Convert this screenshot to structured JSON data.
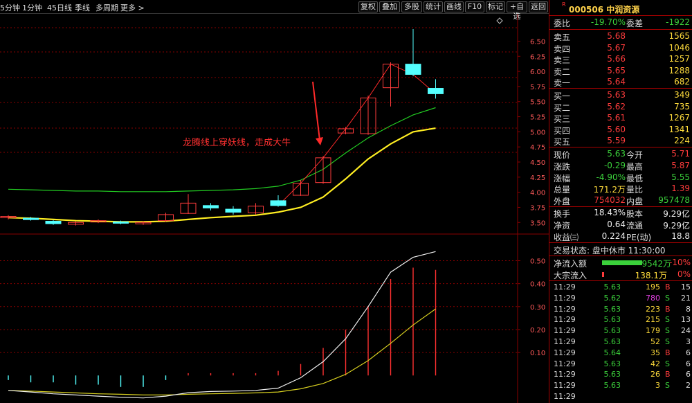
{
  "toolbar": {
    "periods": [
      "5分钟",
      "1分钟",
      "45日线",
      "季线",
      "多周期",
      "更多 >"
    ],
    "buttons": [
      "复权",
      "叠加",
      "多股",
      "统计",
      "画线",
      "F10",
      "标记",
      "+自选",
      "返回"
    ]
  },
  "stock": {
    "badge": "R",
    "title": "000506 中润资源"
  },
  "summary": {
    "weibi_label": "委比",
    "weibi": "-19.70%",
    "weicha_label": "委差",
    "weicha": "-1922"
  },
  "asks": [
    {
      "label": "卖五",
      "price": "5.68",
      "vol": "1565"
    },
    {
      "label": "卖四",
      "price": "5.67",
      "vol": "1046"
    },
    {
      "label": "卖三",
      "price": "5.66",
      "vol": "1257"
    },
    {
      "label": "卖二",
      "price": "5.65",
      "vol": "1288"
    },
    {
      "label": "卖一",
      "price": "5.64",
      "vol": "682"
    }
  ],
  "bids": [
    {
      "label": "买一",
      "price": "5.63",
      "vol": "349"
    },
    {
      "label": "买二",
      "price": "5.62",
      "vol": "735"
    },
    {
      "label": "买三",
      "price": "5.61",
      "vol": "1267"
    },
    {
      "label": "买四",
      "price": "5.60",
      "vol": "1341"
    },
    {
      "label": "买五",
      "price": "5.59",
      "vol": "224"
    }
  ],
  "quote": [
    {
      "l1": "现价",
      "v1": "5.63",
      "c1": "green",
      "l2": "今开",
      "v2": "5.71",
      "c2": "red"
    },
    {
      "l1": "涨跌",
      "v1": "-0.29",
      "c1": "green",
      "l2": "最高",
      "v2": "5.87",
      "c2": "red"
    },
    {
      "l1": "涨幅",
      "v1": "-4.90%",
      "c1": "green",
      "l2": "最低",
      "v2": "5.55",
      "c2": "green"
    },
    {
      "l1": "总量",
      "v1": "171.2万",
      "c1": "yellow",
      "l2": "量比",
      "v2": "1.39",
      "c2": "red"
    },
    {
      "l1": "外盘",
      "v1": "754032",
      "c1": "red",
      "l2": "内盘",
      "v2": "957478",
      "c2": "green"
    }
  ],
  "fundamentals": [
    {
      "l1": "换手",
      "v1": "18.43%",
      "l2": "股本",
      "v2": "9.29亿"
    },
    {
      "l1": "净资",
      "v1": "0.64",
      "l2": "流通",
      "v2": "9.29亿"
    },
    {
      "l1": "收益㈢",
      "v1": "0.224",
      "l2": "PE(动)",
      "v2": "18.8"
    }
  ],
  "trade_status": "交易状态: 盘中休市 11:30:00",
  "flows": {
    "net_label": "净流入额",
    "net_value": "-9542万",
    "net_pct": "-10%",
    "big_label": "大宗流入",
    "big_value": "138.1万",
    "big_pct": "0%"
  },
  "ticks": [
    {
      "time": "11:29",
      "price": "5.63",
      "vol": "195",
      "side": "B",
      "n": "15"
    },
    {
      "time": "11:29",
      "price": "5.62",
      "vol": "780",
      "side": "S",
      "n": "21"
    },
    {
      "time": "11:29",
      "price": "5.63",
      "vol": "223",
      "side": "B",
      "n": "8"
    },
    {
      "time": "11:29",
      "price": "5.63",
      "vol": "215",
      "side": "S",
      "n": "13"
    },
    {
      "time": "11:29",
      "price": "5.63",
      "vol": "179",
      "side": "S",
      "n": "24"
    },
    {
      "time": "11:29",
      "price": "5.63",
      "vol": "52",
      "side": "S",
      "n": "3"
    },
    {
      "time": "11:29",
      "price": "5.64",
      "vol": "35",
      "side": "B",
      "n": "6"
    },
    {
      "time": "11:29",
      "price": "5.63",
      "vol": "42",
      "side": "S",
      "n": "6"
    },
    {
      "time": "11:29",
      "price": "5.63",
      "vol": "26",
      "side": "B",
      "n": "6"
    },
    {
      "time": "11:29",
      "price": "5.63",
      "vol": "3",
      "side": "S",
      "n": "2"
    },
    {
      "time": "11:29",
      "price": "",
      "vol": "",
      "side": "",
      "n": ""
    }
  ],
  "colors": {
    "up": "#ff3c3c",
    "down": "#3bd13b",
    "down_candle": "#54ffff",
    "ma_yellow": "#ffee22",
    "ma_green": "#22cc22",
    "grid": "#8a0000"
  },
  "chart_data": [
    {
      "type": "candlestick",
      "title": "",
      "annotation": "龙腾线上穿妖线，走成大牛",
      "yticks": [
        "6.50",
        "6.25",
        "6.00",
        "5.75",
        "5.50",
        "5.25",
        "5.00",
        "4.75",
        "4.50",
        "4.25",
        "4.00",
        "3.75",
        "3.50"
      ],
      "ylim": [
        3.4,
        6.7
      ],
      "candles": [
        {
          "o": 3.58,
          "c": 3.6,
          "h": 3.62,
          "l": 3.55
        },
        {
          "o": 3.57,
          "c": 3.55,
          "h": 3.59,
          "l": 3.53
        },
        {
          "o": 3.52,
          "c": 3.48,
          "h": 3.54,
          "l": 3.46
        },
        {
          "o": 3.47,
          "c": 3.5,
          "h": 3.52,
          "l": 3.45
        },
        {
          "o": 3.51,
          "c": 3.53,
          "h": 3.55,
          "l": 3.49
        },
        {
          "o": 3.51,
          "c": 3.49,
          "h": 3.53,
          "l": 3.47
        },
        {
          "o": 3.48,
          "c": 3.5,
          "h": 3.52,
          "l": 3.46
        },
        {
          "o": 3.53,
          "c": 3.63,
          "h": 3.66,
          "l": 3.51
        },
        {
          "o": 3.65,
          "c": 3.82,
          "h": 3.97,
          "l": 3.64
        },
        {
          "o": 3.78,
          "c": 3.74,
          "h": 3.82,
          "l": 3.7
        },
        {
          "o": 3.72,
          "c": 3.67,
          "h": 3.77,
          "l": 3.63
        },
        {
          "o": 3.66,
          "c": 3.77,
          "h": 3.82,
          "l": 3.63
        },
        {
          "o": 3.86,
          "c": 3.78,
          "h": 3.95,
          "l": 3.76
        },
        {
          "o": 3.95,
          "c": 4.15,
          "h": 4.2,
          "l": 3.94
        },
        {
          "o": 4.16,
          "c": 4.57,
          "h": 4.6,
          "l": 4.14
        },
        {
          "o": 4.98,
          "c": 5.05,
          "h": 5.08,
          "l": 4.96
        },
        {
          "o": 4.97,
          "c": 5.56,
          "h": 5.6,
          "l": 4.95
        },
        {
          "o": 5.73,
          "c": 6.12,
          "h": 6.15,
          "l": 5.42
        },
        {
          "o": 6.12,
          "c": 5.95,
          "h": 6.7,
          "l": 5.92
        },
        {
          "o": 5.72,
          "c": 5.63,
          "h": 5.87,
          "l": 5.55
        }
      ],
      "ma_yellow": [
        3.58,
        3.57,
        3.55,
        3.53,
        3.52,
        3.51,
        3.51,
        3.52,
        3.55,
        3.58,
        3.6,
        3.62,
        3.67,
        3.75,
        3.92,
        4.22,
        4.55,
        4.8,
        5.0,
        5.06
      ],
      "ma_green": [
        4.05,
        4.04,
        4.03,
        4.02,
        4.02,
        4.01,
        4.01,
        4.01,
        4.02,
        4.03,
        4.04,
        4.06,
        4.1,
        4.2,
        4.38,
        4.65,
        4.9,
        5.1,
        5.28,
        5.4
      ]
    },
    {
      "type": "line",
      "title": "",
      "yticks": [
        "0.50",
        "0.40",
        "0.30",
        "0.20",
        "0.10"
      ],
      "ylim": [
        -0.12,
        0.58
      ],
      "series": [
        {
          "values": [
            -0.065,
            -0.072,
            -0.08,
            -0.085,
            -0.09,
            -0.095,
            -0.098,
            -0.09,
            -0.075,
            -0.07,
            -0.068,
            -0.065,
            -0.055,
            -0.01,
            0.06,
            0.16,
            0.3,
            0.45,
            0.515,
            0.54
          ]
        },
        {
          "values": [
            -0.065,
            -0.068,
            -0.072,
            -0.076,
            -0.08,
            -0.082,
            -0.085,
            -0.085,
            -0.082,
            -0.08,
            -0.078,
            -0.076,
            -0.072,
            -0.058,
            -0.035,
            0.005,
            0.065,
            0.14,
            0.22,
            0.29
          ]
        }
      ],
      "bars": [
        -0.02,
        -0.03,
        -0.03,
        -0.04,
        -0.04,
        -0.05,
        -0.05,
        -0.02,
        0.01,
        0.01,
        0.01,
        0.01,
        0.02,
        0.05,
        0.12,
        0.2,
        0.3,
        0.42,
        0.47,
        0.46
      ]
    }
  ]
}
